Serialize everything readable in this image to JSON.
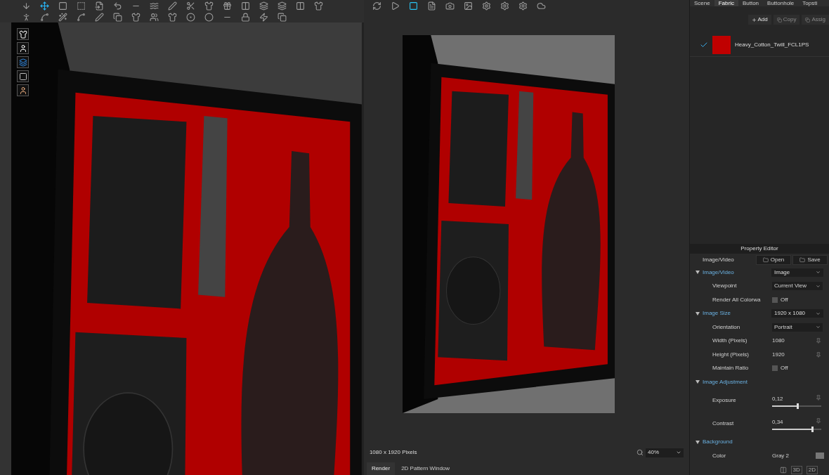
{
  "object_tabs": [
    {
      "label": "Scene",
      "selected": false
    },
    {
      "label": "Fabric",
      "selected": true
    },
    {
      "label": "Button",
      "selected": false
    },
    {
      "label": "Buttonhole",
      "selected": false
    },
    {
      "label": "Topsti",
      "selected": false
    }
  ],
  "fabric_actions": [
    {
      "label": "Add",
      "disabled": false
    },
    {
      "label": "Copy",
      "disabled": true
    },
    {
      "label": "Assig",
      "disabled": true
    }
  ],
  "fabrics": [
    {
      "name": "Heavy_Cotton_Twill_FCL1PS",
      "checked": true,
      "color": "#c00000"
    }
  ],
  "property_editor": {
    "title": "Property Editor",
    "label": "Image/Video",
    "buttons": [
      "Open",
      "Save"
    ],
    "sections": [
      {
        "title": "Image/Video",
        "expanded": true,
        "value": "Image",
        "rows": [
          {
            "kind": "dropdown",
            "label": "Viewpoint",
            "value": "Current View"
          },
          {
            "kind": "checkbox",
            "label": "Render All Colorwa",
            "value": "Off",
            "checked": false
          }
        ]
      },
      {
        "title": "Image Size",
        "expanded": true,
        "value": "1920 x 1080",
        "rows": [
          {
            "kind": "dropdown",
            "label": "Orientation",
            "value": "Portrait"
          },
          {
            "kind": "text",
            "label": "Width (Pixels)",
            "value": "1080"
          },
          {
            "kind": "text",
            "label": "Height (Pixels)",
            "value": "1920"
          },
          {
            "kind": "checkbox",
            "label": "Maintain Ratio",
            "value": "Off",
            "checked": false
          }
        ]
      },
      {
        "title": "Image Adjustment",
        "expanded": true,
        "rows": [
          {
            "kind": "slider",
            "label": "Exposure",
            "value": "0,12",
            "level": 0.52
          },
          {
            "kind": "slider",
            "label": "Contrast",
            "value": "0,34",
            "level": 0.82
          }
        ]
      },
      {
        "title": "Background",
        "expanded": true,
        "rows": [
          {
            "kind": "color",
            "label": "Color",
            "value": "Gray 2"
          }
        ]
      }
    ]
  },
  "render": {
    "status": "1080 x 1920 Pixels",
    "zoom": "40%"
  },
  "bottom_tabs": [
    {
      "label": "Render",
      "selected": true
    },
    {
      "label": "2D Pattern Window",
      "selected": false
    }
  ],
  "view_buttons": [
    "3D",
    "2D"
  ]
}
